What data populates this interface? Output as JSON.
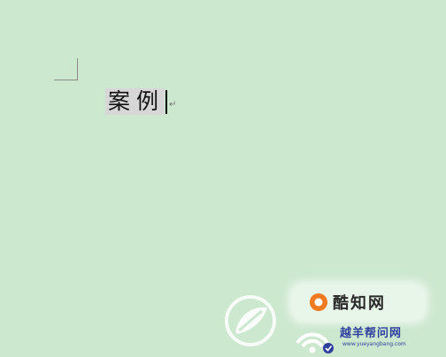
{
  "document": {
    "text": "案例",
    "paragraph_mark": "↵"
  },
  "watermarks": {
    "badge_icon": "orange-circle-logo-icon",
    "badge_text": "酷知网",
    "leaf_icon": "white-leaf-logo-icon",
    "bottom_icon": "wifi-signal-logo-icon",
    "bottom_title": "越羊帮问网",
    "bottom_url": "www.yueyangbang.com"
  },
  "colors": {
    "page_background": "#cce8cf",
    "selection": "#d7d7d7",
    "badge_accent": "#f07a22",
    "bottom_text": "#2e3f9e"
  }
}
